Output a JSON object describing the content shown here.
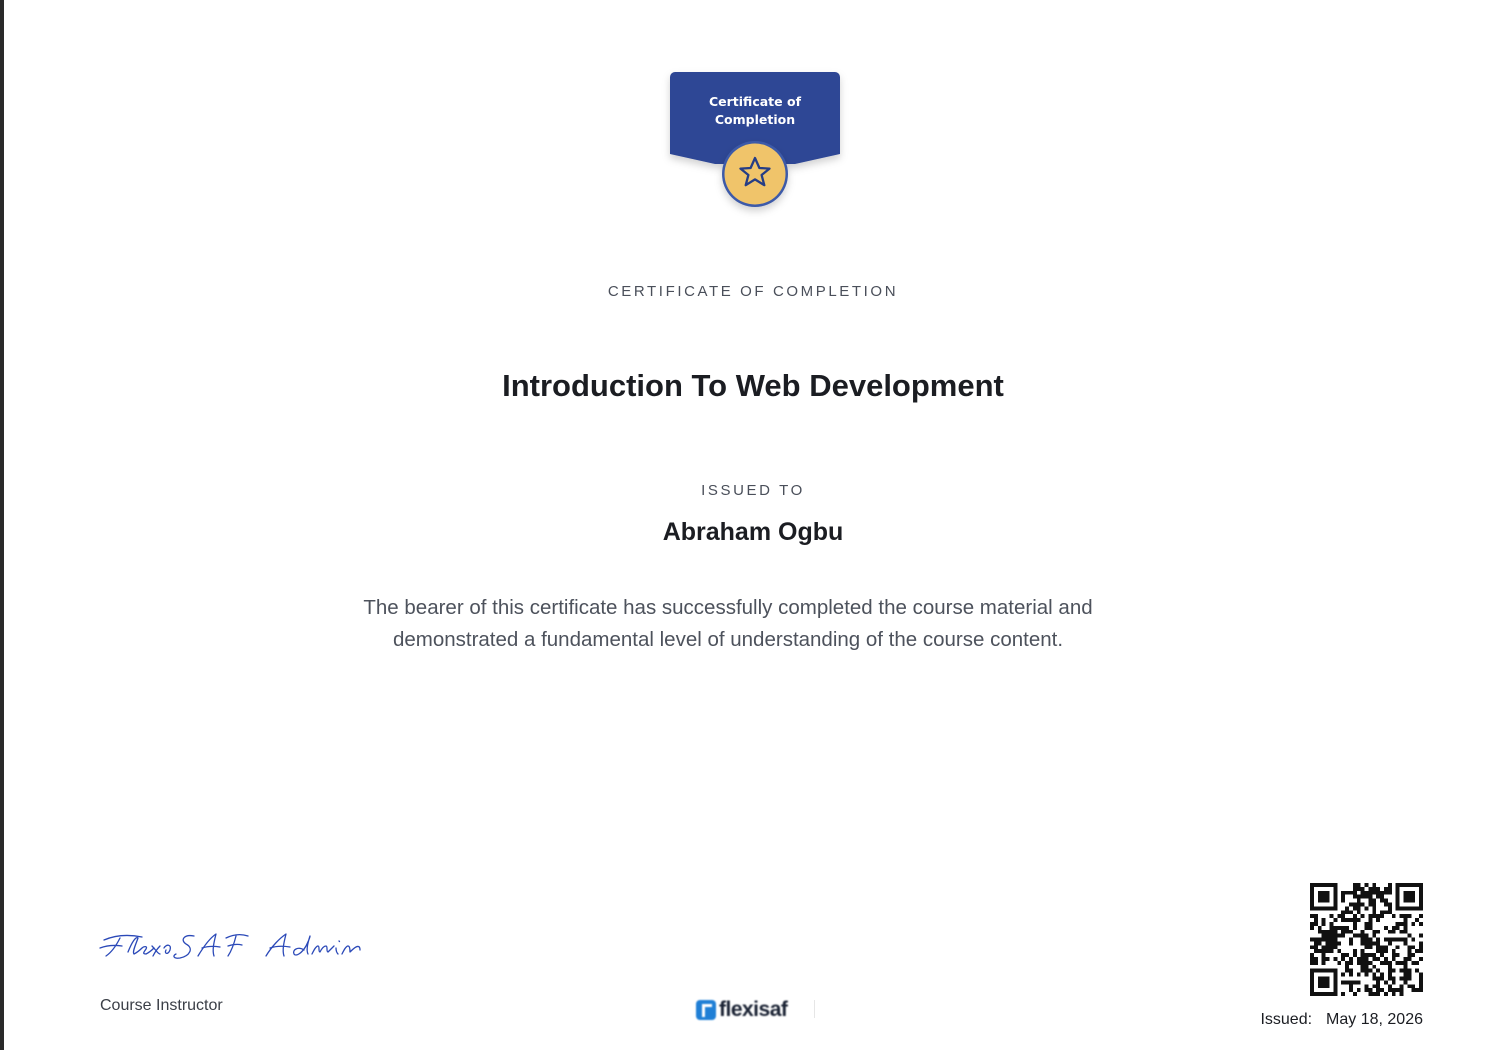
{
  "badge": {
    "line1": "Certificate of",
    "line2": "Completion",
    "colors": {
      "ribbon": "#2e4795",
      "medal": "#f0c46a",
      "medal_ring": "#3e5aa8"
    }
  },
  "certificate": {
    "kicker": "CERTIFICATE OF COMPLETION",
    "course_title": "Introduction To Web Development",
    "issued_to_label": "ISSUED TO",
    "recipient_name": "Abraham Ogbu",
    "description_line1": "The bearer of this certificate has successfully completed the course material and",
    "description_line2": "demonstrated a fundamental level of understanding of the course content."
  },
  "footer": {
    "signature_text": "FlexiSAF Admin",
    "instructor_label": "Course Instructor",
    "logo_text": "flexisaf",
    "issued_label": "Issued:",
    "issued_date": "May 18, 2026"
  }
}
